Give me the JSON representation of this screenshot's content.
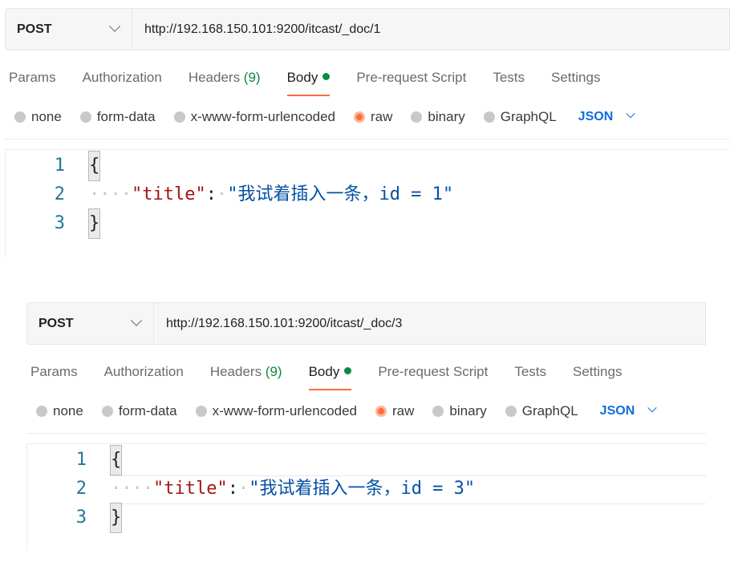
{
  "requests": [
    {
      "method": "POST",
      "url": "http://192.168.150.101:9200/itcast/_doc/1",
      "tabs": [
        {
          "label": "Params"
        },
        {
          "label": "Authorization"
        },
        {
          "label": "Headers ",
          "count": "(9)"
        },
        {
          "label": "Body",
          "active": true,
          "indicator": "green-dot"
        },
        {
          "label": "Pre-request Script"
        },
        {
          "label": "Tests"
        },
        {
          "label": "Settings"
        }
      ],
      "body_types": [
        "none",
        "form-data",
        "x-www-form-urlencoded",
        "raw",
        "binary",
        "GraphQL"
      ],
      "selected_body_type": "raw",
      "format": "JSON",
      "code": {
        "line_numbers": [
          "1",
          "2",
          "3"
        ],
        "open_brace": "{",
        "close_brace": "}",
        "key": "\"title\"",
        "colon": ":",
        "value": "\"我试着插入一条，id = 1\""
      }
    },
    {
      "method": "POST",
      "url": "http://192.168.150.101:9200/itcast/_doc/3",
      "tabs": [
        {
          "label": "Params"
        },
        {
          "label": "Authorization"
        },
        {
          "label": "Headers ",
          "count": "(9)"
        },
        {
          "label": "Body",
          "active": true,
          "indicator": "green-dot"
        },
        {
          "label": "Pre-request Script"
        },
        {
          "label": "Tests"
        },
        {
          "label": "Settings"
        }
      ],
      "body_types": [
        "none",
        "form-data",
        "x-www-form-urlencoded",
        "raw",
        "binary",
        "GraphQL"
      ],
      "selected_body_type": "raw",
      "format": "JSON",
      "code": {
        "line_numbers": [
          "1",
          "2",
          "3"
        ],
        "open_brace": "{",
        "close_brace": "}",
        "key": "\"title\"",
        "colon": ":",
        "value": "\"我试着插入一条，id = 3\""
      }
    }
  ],
  "colors": {
    "accent": "#ff6c37",
    "active_dot": "#0c8a3e",
    "format_link": "#0f6ddc",
    "line_number": "#237893",
    "json_key": "#a31515",
    "json_string": "#0451a5"
  }
}
